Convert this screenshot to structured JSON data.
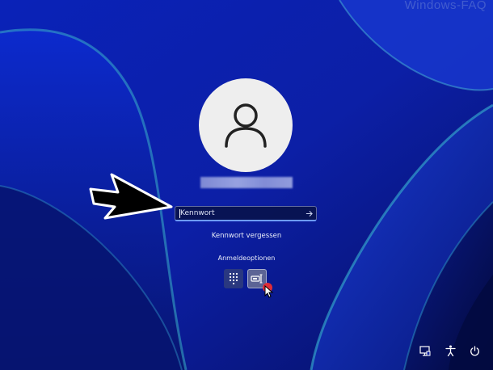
{
  "watermark": "Windows-FAQ",
  "login": {
    "password_placeholder": "Kennwort",
    "forgot_password": "Kennwort vergessen",
    "signin_options_label": "Anmeldeoptionen",
    "options": [
      {
        "name": "pin-icon",
        "selected": false
      },
      {
        "name": "password-key-icon",
        "selected": true
      }
    ]
  },
  "system_icons": [
    "network-icon",
    "accessibility-icon",
    "power-icon"
  ],
  "colors": {
    "background": "#0b1f9e",
    "accent": "#6e9cff",
    "avatar_bg": "#eeeeee",
    "highlight_dot": "#e02c37"
  }
}
